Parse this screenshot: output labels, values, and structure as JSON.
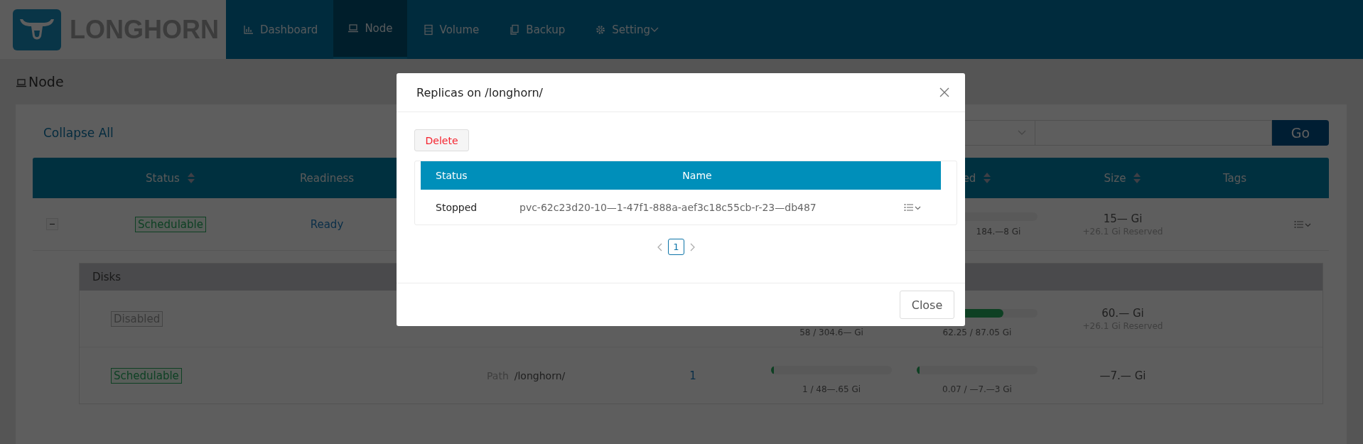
{
  "header": {
    "logo_text": "LONGHORN",
    "nav": [
      {
        "label": "Dashboard",
        "kind": "dashboard",
        "selected": false,
        "dropdown": false
      },
      {
        "label": "Node",
        "kind": "node",
        "selected": true,
        "dropdown": false
      },
      {
        "label": "Volume",
        "kind": "volume",
        "selected": false,
        "dropdown": false
      },
      {
        "label": "Backup",
        "kind": "backup",
        "selected": false,
        "dropdown": false
      },
      {
        "label": "Setting",
        "kind": "setting",
        "selected": false,
        "dropdown": true
      }
    ]
  },
  "page": {
    "title": "Node"
  },
  "toolbar": {
    "collapse_all": "Collapse All",
    "go_button": "Go"
  },
  "table": {
    "columns": [
      {
        "label": "Status",
        "sortable": true
      },
      {
        "label": "Readiness",
        "sortable": false
      },
      {
        "label": "ed",
        "sortable": true
      },
      {
        "label": "Size",
        "sortable": true
      },
      {
        "label": "Tags",
        "sortable": false
      }
    ],
    "rows": [
      {
        "expanded": true,
        "status": {
          "text": "Schedulable",
          "kind": "schedulable"
        },
        "readiness": "Ready",
        "allocated": {
          "reading": "184.—8 Gi"
        },
        "size": "15— Gi",
        "reserved": "+26.1 Gi Reserved",
        "disks": {
          "title": "Disks",
          "rows": [
            {
              "status": {
                "text": "Disabled",
                "kind": "disabled"
              },
              "storage": {
                "reading": "58 / 304.6— Gi"
              },
              "allocated": {
                "level": 0.72,
                "reading": "62.25 / 87.05 Gi"
              },
              "size": "60.— Gi",
              "reserved": "+26.1 Gi Reserved"
            },
            {
              "status": {
                "text": "Schedulable",
                "kind": "schedulable"
              },
              "path_label": "Path",
              "path": "/longhorn/",
              "replicas": "1",
              "storage": {
                "level": 0.02,
                "reading": "1 / 48—.65 Gi"
              },
              "allocated": {
                "level": 0.01,
                "reading": "0.07 / —7.—3 Gi"
              },
              "size": "—7.— Gi"
            }
          ]
        }
      }
    ]
  },
  "modal": {
    "title": "Replicas on /longhorn/",
    "delete_button": "Delete",
    "columns": [
      "Status",
      "Name"
    ],
    "rows": [
      {
        "status": "Stopped",
        "name": "pvc-62c23d20-10—1-47f1-888a-aef3c18c55cb-r-23—db487"
      }
    ],
    "pages": [
      {
        "label": "1",
        "selected": true
      }
    ],
    "close_button": "Close"
  }
}
